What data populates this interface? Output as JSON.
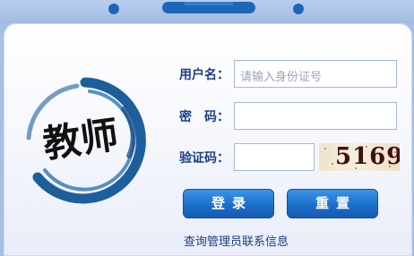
{
  "login": {
    "username_label": "用户名：",
    "username_placeholder": "请输入身份证号",
    "password_label": "密　码：",
    "captcha_label": "验证码：",
    "captcha_code": "5169",
    "login_button": "登录",
    "reset_button": "重置",
    "admin_contact_link": "查询管理员联系信息"
  },
  "logo": {
    "text": "教师"
  },
  "colors": {
    "accent": "#1c6fcb",
    "label": "#1b3f86",
    "logo": "#1d5f9c"
  }
}
